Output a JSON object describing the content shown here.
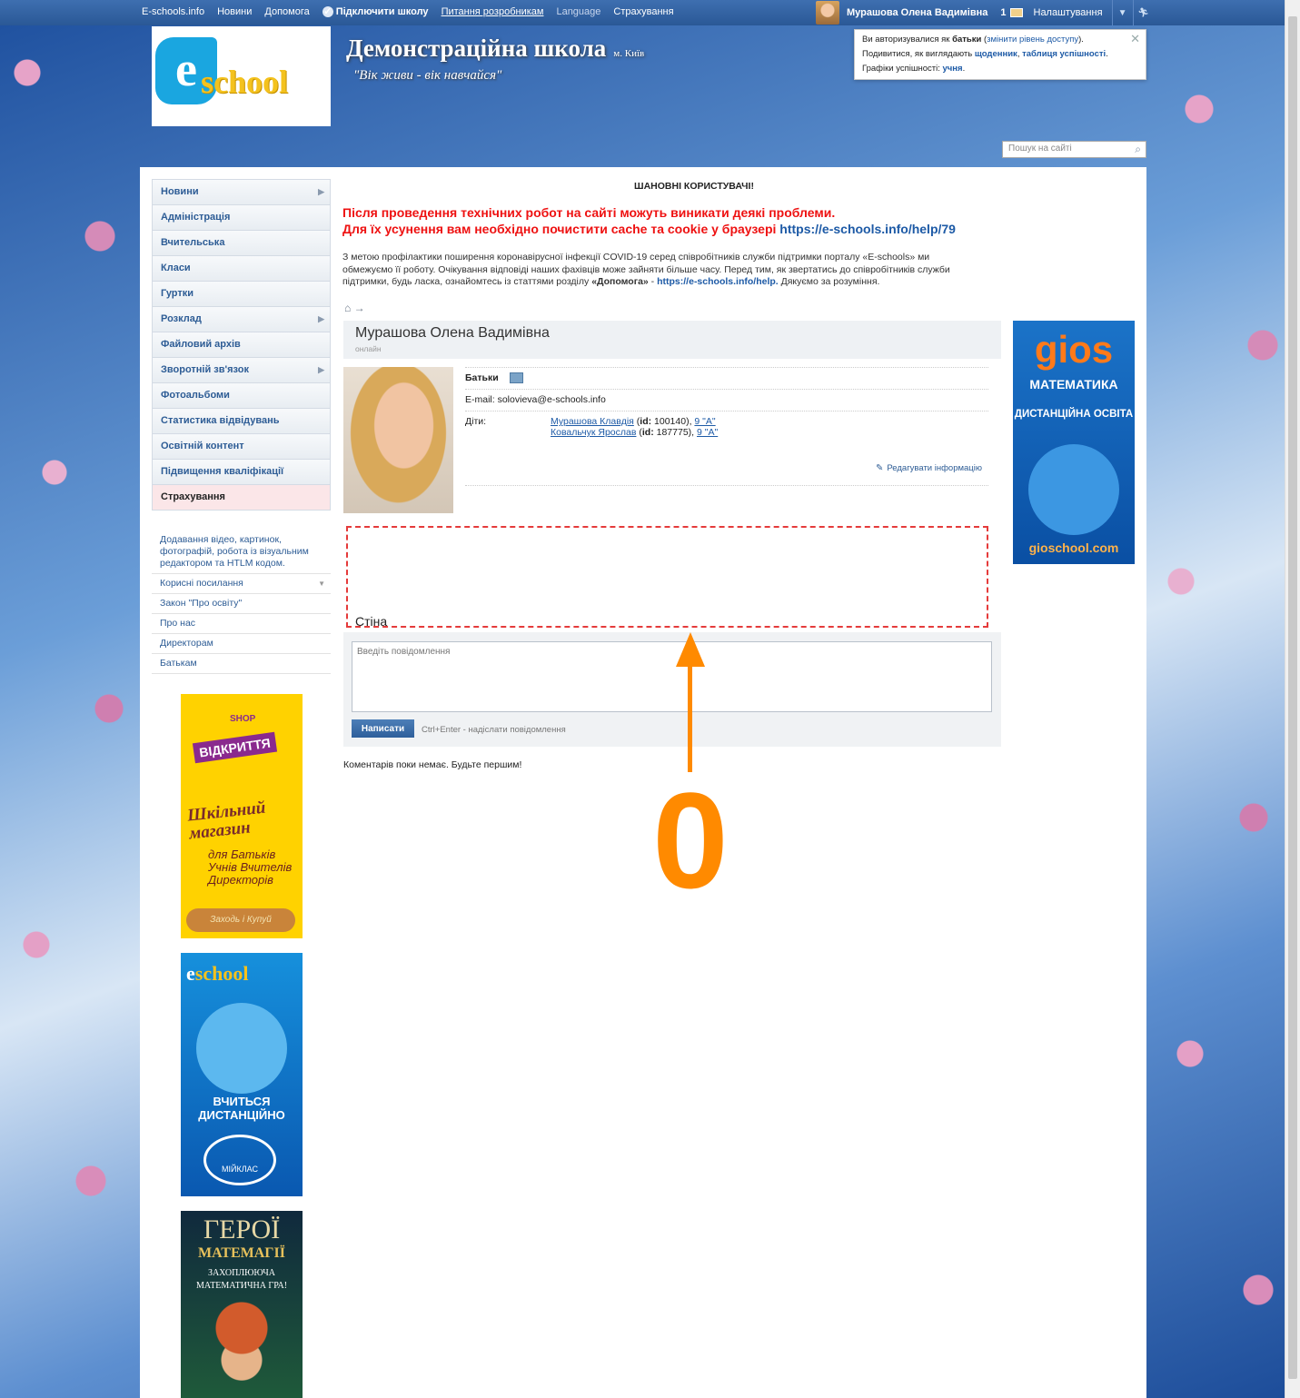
{
  "topbar": {
    "nav": [
      "E-schools.info",
      "Новини",
      "Допомога"
    ],
    "connect_school": "Підключити школу",
    "dev_questions": "Питання розробникам",
    "language": "Language",
    "insurance": "Страхування",
    "user_name": "Мурашова Олена Вадимівна",
    "messages_count": "1",
    "settings": "Налаштування"
  },
  "header": {
    "school_name": "Демонстраційна школа",
    "city": "м. Київ",
    "motto": "\"Вік живи - вік навчайся\"",
    "logo_e": "e",
    "logo_text": "school",
    "search_placeholder": "Пошук на сайті"
  },
  "auth_notice": {
    "line1_pre": "Ви авторизувалися як",
    "role": "батьки",
    "change_link": "змінити рівень доступу",
    "line2_pre": "Подивитися, як виглядають",
    "diary_link": "щоденник",
    "grades_link": "таблиця успішності",
    "line3_pre": "Графіки успішності:",
    "student_link": "учня"
  },
  "sidebar": {
    "items": [
      {
        "label": "Новини",
        "arrow": true
      },
      {
        "label": "Адміністрація",
        "arrow": false
      },
      {
        "label": "Вчительська",
        "arrow": false
      },
      {
        "label": "Класи",
        "arrow": false
      },
      {
        "label": "Гуртки",
        "arrow": false
      },
      {
        "label": "Розклад",
        "arrow": true
      },
      {
        "label": "Файловий архів",
        "arrow": false
      },
      {
        "label": "Зворотній зв'язок",
        "arrow": true
      },
      {
        "label": "Фотоальбоми",
        "arrow": false
      },
      {
        "label": "Статистика відвідувань",
        "arrow": false
      },
      {
        "label": "Освітній контент",
        "arrow": false
      },
      {
        "label": "Підвищення кваліфікації",
        "arrow": false
      },
      {
        "label": "Страхування",
        "arrow": false
      }
    ],
    "links": [
      "Додавання відео, картинок, фотографій, робота із візуальним редактором та HTLM кодом.",
      "Корисні посилання",
      "Закон \"Про освіту\"",
      "Про нас",
      "Директорам",
      "Батькам"
    ]
  },
  "banners": {
    "shop": {
      "tag": "ВІДКРИТТЯ",
      "shop": "SHOP",
      "title": "Шкільний магазин",
      "for": "для Батьків Учнів Вчителів Директорів",
      "cta": "Заходь і Купуй"
    },
    "distance": {
      "logo_e": "e",
      "logo_text": "school",
      "text": "ВЧИТЬСЯ ДИСТАНЦІЙНО",
      "brand": "МІЙКЛАС"
    },
    "game": {
      "title": "ГЕРОЇ",
      "subtitle": "МАТЕМАГІЇ",
      "tagline": "ЗАХОПЛЮЮЧА МАТЕМАТИЧНА ГРА!"
    }
  },
  "announcement": {
    "title": "ШАНОВНІ КОРИСТУВАЧІ!",
    "red_line1": "Після проведення технічних робот на сайті можуть виникати деякі проблеми.",
    "red_line2_pre": "Для їх усунення вам необхідно почистити cache та cookie у браузері",
    "red_link": "https://e-schools.info/help/79",
    "text_pre": "З метою профілактики поширення коронавірусної інфекції COVID-19 серед співробітників служби підтримки порталу «E-schools» ми обмежуємо її роботу. Очікування відповіді наших фахівців може зайняти більше часу. Перед тим, як звертатись до співробітників служби підтримки, будь ласка, ознайомтесь із статтями розділу",
    "help_bold": "«Допомога»",
    "help_link": "https://e-schools.info/help.",
    "text_post": "Дякуємо за розуміння."
  },
  "profile": {
    "name": "Мурашова Олена Вадимівна",
    "status": "онлайн",
    "role": "Батьки",
    "email_label": "E-mail:",
    "email": "solovieva@e-schools.info",
    "children_label": "Діти:",
    "children": [
      {
        "name": "Мурашова Клавдія",
        "id_label": "id:",
        "id": "100140",
        "class": "9 \"А\""
      },
      {
        "name": "Ковальчук Ярослав",
        "id_label": "id:",
        "id": "187775",
        "class": "9 \"А\""
      }
    ],
    "edit_label": "Редагувати інформацію"
  },
  "wall": {
    "title": "Стіна",
    "placeholder": "Введіть повідомлення",
    "send_label": "Написати",
    "hint": "Ctrl+Enter - надіслати повідомлення",
    "no_comments": "Коментарів поки немає. Будьте першим!"
  },
  "ad": {
    "brand": "gios",
    "subject": "МАТЕМАТИКА",
    "tagline": "ДИСТАНЦІЙНА ОСВІТА",
    "url": "gioschool.com"
  },
  "annotation": {
    "number": "0",
    "color": "#ff8a00",
    "highlight_color": "#e53b3b"
  }
}
